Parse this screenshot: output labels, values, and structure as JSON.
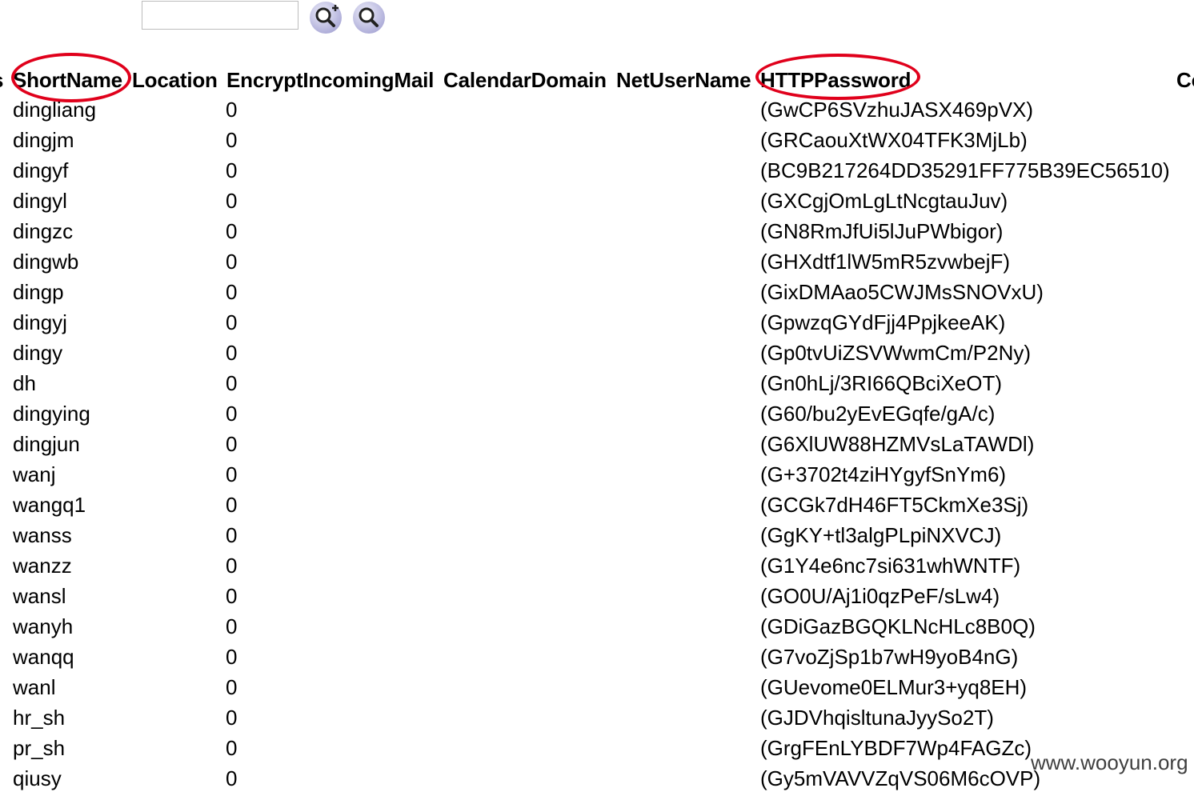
{
  "toolbar": {
    "search_value": "",
    "add_search_icon": "magnifier-plus-icon",
    "search_icon": "magnifier-icon",
    "icon_color": "#b9b8e0"
  },
  "table": {
    "columns": [
      "s",
      "ShortName",
      "Location",
      "EncryptIncomingMail",
      "CalendarDomain",
      "NetUserName",
      "HTTPPassword",
      "Co"
    ],
    "rows": [
      {
        "shortname": "dingliang",
        "encrypt": "0",
        "httppassword": "(GwCP6SVzhuJASX469pVX)"
      },
      {
        "shortname": "dingjm",
        "encrypt": "0",
        "httppassword": "(GRCaouXtWX04TFK3MjLb)"
      },
      {
        "shortname": "dingyf",
        "encrypt": "0",
        "httppassword": "(BC9B217264DD35291FF775B39EC56510)"
      },
      {
        "shortname": "dingyl",
        "encrypt": "0",
        "httppassword": "(GXCgjOmLgLtNcgtauJuv)"
      },
      {
        "shortname": "dingzc",
        "encrypt": "0",
        "httppassword": "(GN8RmJfUi5lJuPWbigor)"
      },
      {
        "shortname": "dingwb",
        "encrypt": "0",
        "httppassword": "(GHXdtf1lW5mR5zvwbejF)"
      },
      {
        "shortname": "dingp",
        "encrypt": "0",
        "httppassword": "(GixDMAao5CWJMsSNOVxU)"
      },
      {
        "shortname": "dingyj",
        "encrypt": "0",
        "httppassword": "(GpwzqGYdFjj4PpjkeeAK)"
      },
      {
        "shortname": "dingy",
        "encrypt": "0",
        "httppassword": "(Gp0tvUiZSVWwmCm/P2Ny)"
      },
      {
        "shortname": "dh",
        "encrypt": "0",
        "httppassword": "(Gn0hLj/3RI66QBciXeOT)"
      },
      {
        "shortname": "dingying",
        "encrypt": "0",
        "httppassword": "(G60/bu2yEvEGqfe/gA/c)"
      },
      {
        "shortname": "dingjun",
        "encrypt": "0",
        "httppassword": "(G6XlUW88HZMVsLaTAWDl)"
      },
      {
        "shortname": "wanj",
        "encrypt": "0",
        "httppassword": "(G+3702t4ziHYgyfSnYm6)"
      },
      {
        "shortname": "wangq1",
        "encrypt": "0",
        "httppassword": "(GCGk7dH46FT5CkmXe3Sj)"
      },
      {
        "shortname": "wanss",
        "encrypt": "0",
        "httppassword": "(GgKY+tl3algPLpiNXVCJ)"
      },
      {
        "shortname": "wanzz",
        "encrypt": "0",
        "httppassword": "(G1Y4e6nc7si631whWNTF)"
      },
      {
        "shortname": "wansl",
        "encrypt": "0",
        "httppassword": "(GO0U/Aj1i0qzPeF/sLw4)"
      },
      {
        "shortname": "wanyh",
        "encrypt": "0",
        "httppassword": "(GDiGazBGQKLNcHLc8B0Q)"
      },
      {
        "shortname": "wanqq",
        "encrypt": "0",
        "httppassword": "(G7voZjSp1b7wH9yoB4nG)"
      },
      {
        "shortname": "wanl",
        "encrypt": "0",
        "httppassword": "(GUevome0ELMur3+yq8EH)"
      },
      {
        "shortname": "hr_sh",
        "encrypt": "0",
        "httppassword": "(GJDVhqisltunaJyySo2T)"
      },
      {
        "shortname": "pr_sh",
        "encrypt": "0",
        "httppassword": "(GrgFEnLYBDF7Wp4FAGZc)"
      },
      {
        "shortname": "qiusy",
        "encrypt": "0",
        "httppassword": "(Gy5mVAVVZqVS06M6cOVP)"
      }
    ]
  },
  "annotations": {
    "highlight_color": "#e0001b",
    "circled_columns": [
      "ShortName",
      "HTTPPassword"
    ]
  },
  "watermark": "www.wooyun.org"
}
